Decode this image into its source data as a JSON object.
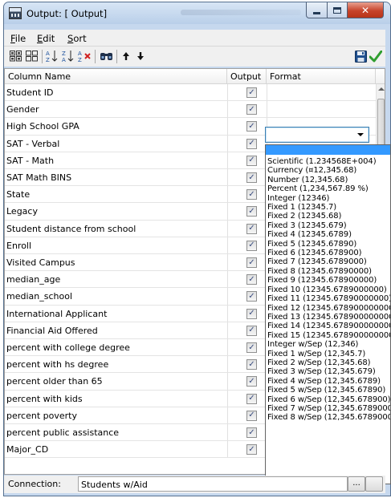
{
  "window": {
    "title": "Output: [ Output]"
  },
  "menu": [
    {
      "prefix": "",
      "accel": "F",
      "rest": "ile"
    },
    {
      "prefix": "",
      "accel": "E",
      "rest": "dit"
    },
    {
      "prefix": "",
      "accel": "S",
      "rest": "ort"
    }
  ],
  "toolbar": {
    "icons": [
      "grid-view-icon",
      "list-view-icon",
      "sort-ascending-icon",
      "sort-descending-icon",
      "clear-sort-icon",
      "find-icon",
      "move-up-icon",
      "move-down-icon",
      "save-icon",
      "apply-checkmark-icon"
    ]
  },
  "grid": {
    "headers": {
      "name": "Column Name",
      "output": "Output",
      "format": "Format"
    },
    "rows": [
      {
        "name": "Student ID",
        "checked": true
      },
      {
        "name": "Gender",
        "checked": true
      },
      {
        "name": "High School GPA",
        "checked": true
      },
      {
        "name": "SAT - Verbal",
        "checked": true
      },
      {
        "name": "SAT - Math",
        "checked": true
      },
      {
        "name": "SAT Math BINS",
        "checked": true
      },
      {
        "name": "State",
        "checked": true
      },
      {
        "name": "Legacy",
        "checked": true
      },
      {
        "name": "Student distance from school",
        "checked": true
      },
      {
        "name": "Enroll",
        "checked": true
      },
      {
        "name": "Visited Campus",
        "checked": true
      },
      {
        "name": "median_age",
        "checked": true
      },
      {
        "name": "median_school",
        "checked": true
      },
      {
        "name": "International Applicant",
        "checked": true
      },
      {
        "name": "Financial Aid Offered",
        "checked": true
      },
      {
        "name": "percent with college degree",
        "checked": true
      },
      {
        "name": "percent with hs degree",
        "checked": true
      },
      {
        "name": "percent older than 65",
        "checked": true
      },
      {
        "name": "percent with kids",
        "checked": true
      },
      {
        "name": "percent poverty",
        "checked": true
      },
      {
        "name": "percent public assistance",
        "checked": true
      },
      {
        "name": "Major_CD",
        "checked": true
      }
    ]
  },
  "format_dropdown": {
    "selected_value": "",
    "options": [
      "Scientific (1.234568E+004)",
      "Currency (¤12,345.68)",
      "Number (12,345.68)",
      "Percent (1,234,567.89 %)",
      "Integer (12346)",
      "Fixed 1 (12345.7)",
      "Fixed 2 (12345.68)",
      "Fixed 3 (12345.679)",
      "Fixed 4 (12345.6789)",
      "Fixed 5 (12345.67890)",
      "Fixed 6 (12345.678900)",
      "Fixed 7 (12345.6789000)",
      "Fixed 8 (12345.67890000)",
      "Fixed 9 (12345.678900000)",
      "Fixed 10 (12345.6789000000)",
      "Fixed 11 (12345.67890000000)",
      "Fixed 12 (12345.678900000000)",
      "Fixed 13 (12345.6789000000000)",
      "Fixed 14 (12345.67890000000000)",
      "Fixed 15 (12345.678900000000000)",
      "Integer w/Sep (12,346)",
      "Fixed 1 w/Sep (12,345.7)",
      "Fixed 2 w/Sep (12,345.68)",
      "Fixed 3 w/Sep (12,345.679)",
      "Fixed 4 w/Sep (12,345.6789)",
      "Fixed 5 w/Sep (12,345.67890)",
      "Fixed 6 w/Sep (12,345.678900)",
      "Fixed 7 w/Sep (12,345.6789000)",
      "Fixed 8 w/Sep (12,345.67890000)"
    ]
  },
  "status": {
    "connection_label": "Connection:",
    "connection_value": "Students w/Aid",
    "browse_button": "..."
  },
  "colors": {
    "selection": "#3399ff",
    "title_gradient_top": "#d7e5f5",
    "close_button": "#c7432a",
    "checkmark": "#3a4d80",
    "apply_check": "#2f9e2f"
  }
}
